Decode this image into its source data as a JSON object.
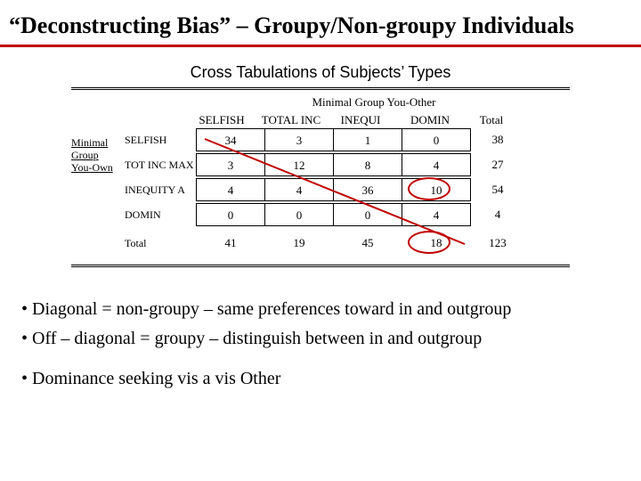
{
  "title": "“Deconstructing Bias” – Groupy/Non-groupy Individuals",
  "subtitle": "Cross Tabulations of Subjects’ Types",
  "table": {
    "top_header": "Minimal Group You-Other",
    "side_header": {
      "l1": "Minimal",
      "l2": "Group",
      "l3": "You-Own"
    },
    "cols": {
      "c1": "SELFISH",
      "c2": "TOTAL INC",
      "c3": "INEQUI",
      "c4": "DOMIN",
      "ctot": "Total"
    },
    "rows": {
      "r1": {
        "name": "SELFISH",
        "c1": "34",
        "c2": "3",
        "c3": "1",
        "c4": "0",
        "tot": "38"
      },
      "r2": {
        "name": "TOT INC MAX",
        "c1": "3",
        "c2": "12",
        "c3": "8",
        "c4": "4",
        "tot": "27"
      },
      "r3": {
        "name": "INEQUITY A",
        "c1": "4",
        "c2": "4",
        "c3": "36",
        "c4": "10",
        "tot": "54"
      },
      "r4": {
        "name": "DOMIN",
        "c1": "0",
        "c2": "0",
        "c3": "0",
        "c4": "4",
        "tot": "4"
      },
      "rtot": {
        "name": "Total",
        "c1": "41",
        "c2": "19",
        "c3": "45",
        "c4": "18",
        "tot": "123"
      }
    }
  },
  "bullets": {
    "b1": "Diagonal = non-groupy – same preferences toward in and outgroup",
    "b2": "Off – diagonal = groupy – distinguish between in and outgroup",
    "b3": "Dominance seeking vis a vis Other"
  },
  "annotations": {
    "color": "#C00000",
    "circled_cells": [
      "r3.c4",
      "rtot.c4"
    ],
    "diagonal_from": "r1.c1",
    "diagonal_to": "rtot.c4"
  }
}
